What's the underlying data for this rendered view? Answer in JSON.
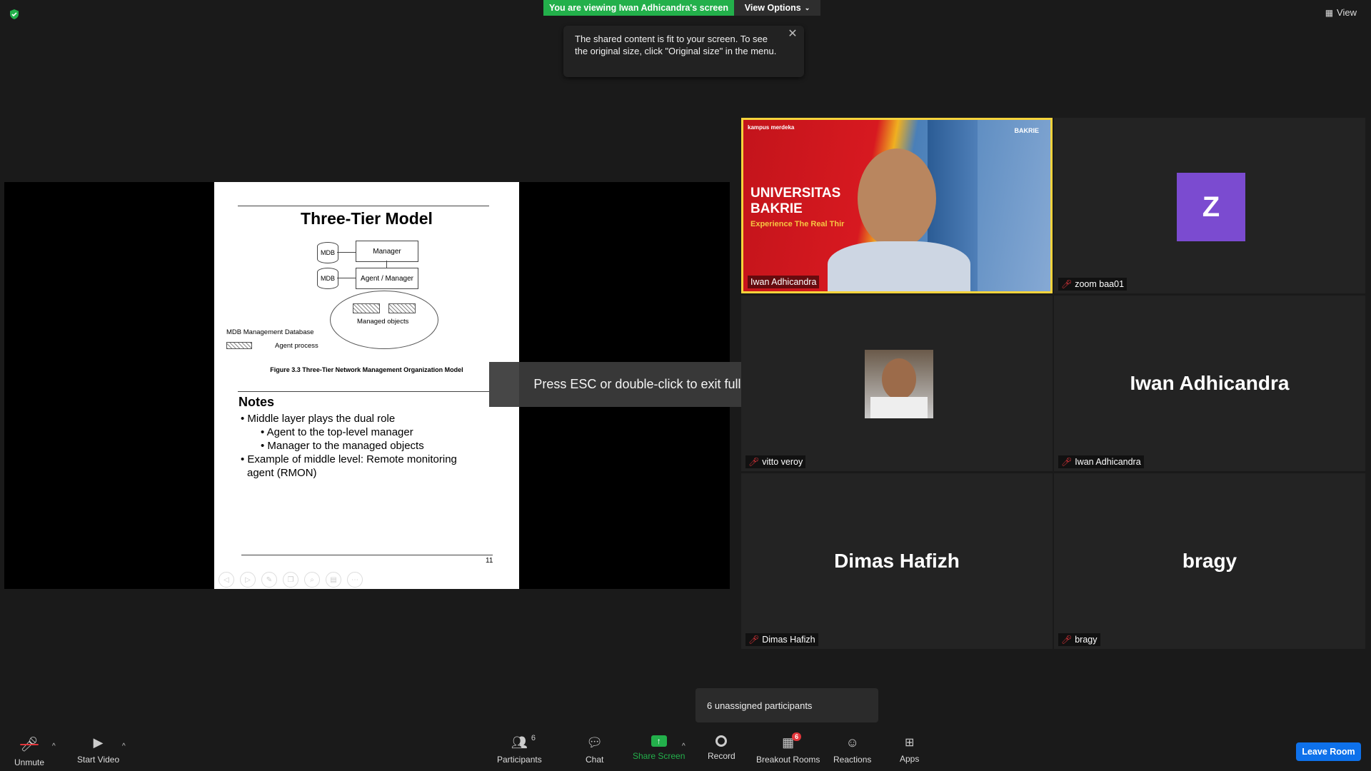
{
  "banner": {
    "viewing_text": "You are viewing Iwan Adhicandra's screen",
    "view_options_label": "View Options",
    "view_label": "View"
  },
  "tooltip": {
    "text": "The shared content is fit to your screen. To see the original size, click \"Original size\" in the menu."
  },
  "slide": {
    "title": "Three-Tier Model",
    "manager_box": "Manager",
    "agent_manager_box": "Agent / Manager",
    "mdb_label": "MDB",
    "managed_objects": "Managed objects",
    "legend_mdb": "MDB  Management Database",
    "legend_agent": "Agent process",
    "figure_caption": "Figure 3.3  Three-Tier Network Management Organization Model",
    "notes_title": "Notes",
    "notes": [
      "• Middle layer plays the dual role",
      "• Agent to the top-level manager",
      "• Manager to the managed objects",
      "• Example of middle level: Remote monitoring",
      "agent (RMON)"
    ],
    "page_number": "11"
  },
  "fullscreen_hint": "Press ESC or double-click to exit full screen mode",
  "speaker_video": {
    "university_line1": "UNIVERSITAS",
    "university_line2": "BAKRIE",
    "tagline": "Experience The Real Thir",
    "logo_text": "BAKRIE",
    "corner_logo": "kampus merdeka"
  },
  "participants_tiles": [
    {
      "name": "Iwan Adhicandra",
      "muted": false
    },
    {
      "name": "zoom baa01",
      "muted": true,
      "avatar_letter": "Z"
    },
    {
      "name": "vitto veroy",
      "muted": true
    },
    {
      "name": "Iwan Adhicandra",
      "muted": true,
      "display": "Iwan Adhicandra"
    },
    {
      "name": "Dimas Hafizh",
      "muted": true,
      "display": "Dimas Hafizh"
    },
    {
      "name": "bragy",
      "muted": true,
      "display": "bragy"
    }
  ],
  "unassigned_popup": "6 unassigned participants",
  "toolbar": {
    "unmute": "Unmute",
    "start_video": "Start Video",
    "participants": "Participants",
    "participants_count": "6",
    "chat": "Chat",
    "share_screen": "Share Screen",
    "record": "Record",
    "breakout_rooms": "Breakout Rooms",
    "breakout_badge": "6",
    "reactions": "Reactions",
    "apps": "Apps",
    "leave_room": "Leave Room"
  },
  "colors": {
    "accent_green": "#23b04b",
    "leave_blue": "#0e71eb",
    "active_speaker": "#f5d33b",
    "muted_red": "#e2353a",
    "avatar_purple": "#7b4bd0"
  }
}
